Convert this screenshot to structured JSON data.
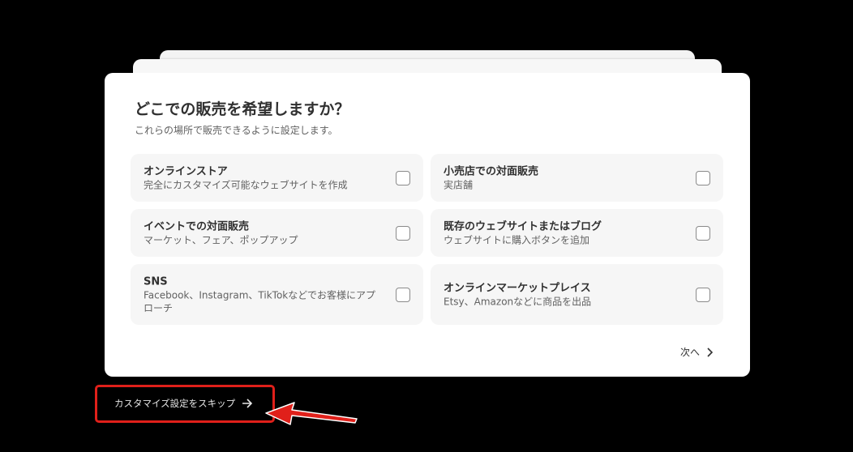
{
  "dialog": {
    "title": "どこでの販売を希望しますか？",
    "subtitle": "これらの場所で販売できるように設定します。",
    "options": [
      {
        "title": "オンラインストア",
        "desc": "完全にカスタマイズ可能なウェブサイトを作成",
        "checked": false
      },
      {
        "title": "小売店での対面販売",
        "desc": "実店舗",
        "checked": false
      },
      {
        "title": "イベントでの対面販売",
        "desc": "マーケット、フェア、ポップアップ",
        "checked": false
      },
      {
        "title": "既存のウェブサイトまたはブログ",
        "desc": "ウェブサイトに購入ボタンを追加",
        "checked": false
      },
      {
        "title": "SNS",
        "desc": "Facebook、Instagram、TikTokなどでお客様にアプローチ",
        "checked": false
      },
      {
        "title": "オンラインマーケットプレイス",
        "desc": "Etsy、Amazonなどに商品を出品",
        "checked": false
      }
    ],
    "next_label": "次へ"
  },
  "skip_label": "カスタマイズ設定をスキップ",
  "colors": {
    "annotation": "#e0201a"
  }
}
